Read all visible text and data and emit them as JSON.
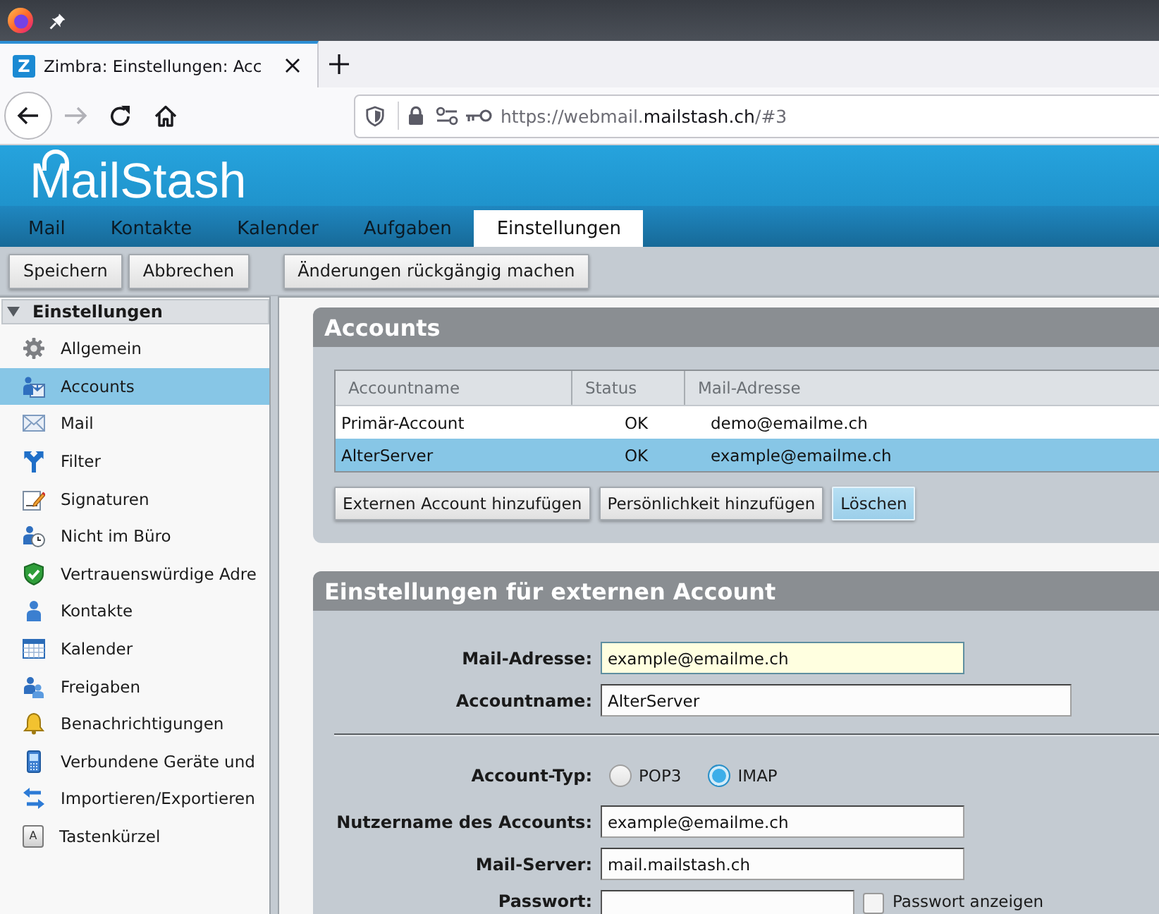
{
  "browser_tab": {
    "favicon": "Z",
    "title": "Zimbra: Einstellungen: Acc"
  },
  "nav_buttons": [
    {
      "kind": "back",
      "disabled": false
    },
    {
      "kind": "forward",
      "disabled": true
    },
    {
      "kind": "reload",
      "disabled": false
    },
    {
      "kind": "home",
      "disabled": false
    }
  ],
  "address_bar": {
    "url_start": "https://webmail.",
    "url_domain": "mailstash.ch",
    "url_end": "/#3"
  },
  "app_header": {
    "logo": "MailStash"
  },
  "app_tabs": [
    {
      "label": "Mail",
      "selected": false
    },
    {
      "label": "Kontakte",
      "selected": false
    },
    {
      "label": "Kalender",
      "selected": false
    },
    {
      "label": "Aufgaben",
      "selected": false
    },
    {
      "label": "Einstellungen",
      "selected": true
    }
  ],
  "toolbar": {
    "button_groups": [
      [
        "Speichern",
        "Abbrechen"
      ],
      [
        "Änderungen rückgängig machen"
      ]
    ]
  },
  "sidebar": {
    "title": "Einstellungen",
    "expanded": true,
    "items": [
      {
        "label": "Allgemein",
        "selected": false
      },
      {
        "label": "Accounts",
        "selected": true
      },
      {
        "label": "Mail",
        "selected": false
      },
      {
        "label": "Filter",
        "selected": false
      },
      {
        "label": "Signaturen",
        "selected": false
      },
      {
        "label": "Nicht im Büro",
        "selected": false
      },
      {
        "label": "Vertrauenswürdige Adre",
        "selected": false
      },
      {
        "label": "Kontakte",
        "selected": false
      },
      {
        "label": "Kalender",
        "selected": false
      },
      {
        "label": "Freigaben",
        "selected": false
      },
      {
        "label": "Benachrichtigungen",
        "selected": false
      },
      {
        "label": "Verbundene Geräte und",
        "selected": false
      },
      {
        "label": "Importieren/Exportieren",
        "selected": false
      },
      {
        "label": "Tastenkürzel",
        "selected": false,
        "icon_letter": "A"
      }
    ]
  },
  "accounts_panel": {
    "title": "Accounts",
    "table": {
      "columns": [
        "Accountname",
        "Status",
        "Mail-Adresse"
      ],
      "rows": [
        {
          "cells": [
            "Primär-Account",
            "OK",
            "demo@emailme.ch"
          ],
          "selected": false
        },
        {
          "cells": [
            "AlterServer",
            "OK",
            "example@emailme.ch"
          ],
          "selected": true
        }
      ]
    },
    "buttons": [
      {
        "label": "Externen Account hinzufügen",
        "focused": false
      },
      {
        "label": "Persönlichkeit hinzufügen",
        "focused": false
      },
      {
        "label": "Löschen",
        "focused": true
      }
    ]
  },
  "external_account_panel": {
    "title": "Einstellungen für externen Account",
    "account_fields": [
      {
        "label": "Mail-Adresse:",
        "value": "example@emailme.ch",
        "focused": true
      },
      {
        "label": "Accountname:",
        "value": "AlterServer",
        "focused": false
      }
    ],
    "server_fields": [
      {
        "kind": "radio",
        "label": "Account-Typ:",
        "options": [
          {
            "label": "POP3",
            "selected": false
          },
          {
            "label": "IMAP",
            "selected": true
          }
        ]
      },
      {
        "kind": "text",
        "label": "Nutzername des Accounts:",
        "value": "example@emailme.ch",
        "focused": false
      },
      {
        "kind": "text",
        "label": "Mail-Server:",
        "value": "mail.mailstash.ch",
        "focused": false
      },
      {
        "kind": "password",
        "label": "Passwort:",
        "focused": false,
        "show_password": {
          "label": "Passwort anzeigen",
          "checked": false
        }
      }
    ]
  }
}
